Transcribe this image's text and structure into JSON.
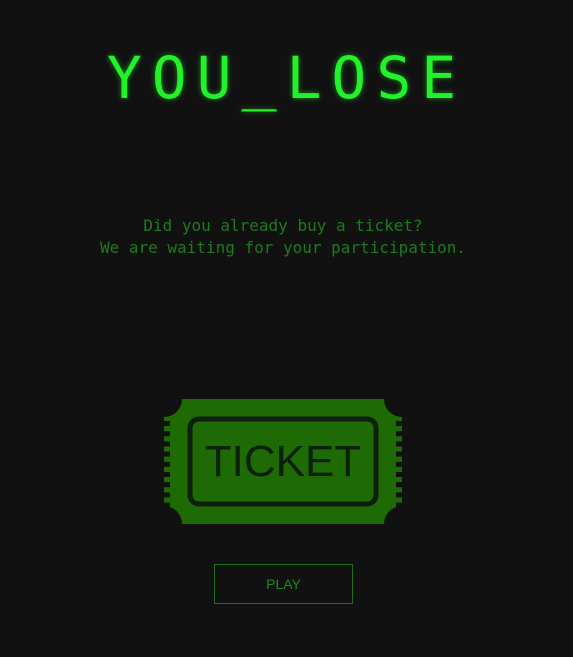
{
  "title": "YOU_LOSE",
  "message": {
    "line1": "Did you already buy a ticket?",
    "line2": "We are waiting for your participation."
  },
  "ticket": {
    "label": "TICKET",
    "color": "#1e6a04"
  },
  "play_button": {
    "label": "PLAY"
  },
  "colors": {
    "background": "#111111",
    "title": "#22f22a",
    "message": "#1d7a1d",
    "button": "#1f8a1f"
  }
}
